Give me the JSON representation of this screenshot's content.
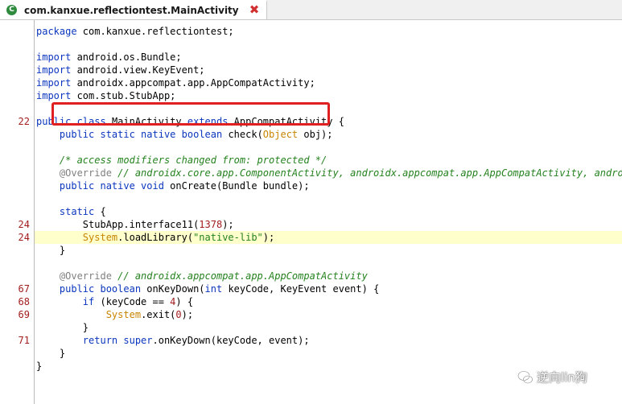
{
  "tab": {
    "icon_letter": "C",
    "title": "com.kanxue.reflectiontest.MainActivity"
  },
  "code": {
    "package_kw": "package",
    "package_name": " com.kanxue.reflectiontest;",
    "import_kw": "import",
    "imports": [
      " android.os.Bundle;",
      " android.view.KeyEvent;",
      " androidx.appcompat.app.AppCompatActivity;",
      " com.stub.StubApp;"
    ],
    "class_decl": {
      "public": "public",
      "class": "class",
      "name": " MainActivity ",
      "extends": "extends",
      "parent": " AppCompatActivity {"
    },
    "native_decl": {
      "mods": "public static native",
      "type": "boolean",
      "rest1": " check(",
      "param_type": "Object",
      "rest2": " obj);"
    },
    "comment1": "/* access modifiers changed from: protected */",
    "override1": "@Override",
    "comment2": " // androidx.core.app.ComponentActivity, androidx.appcompat.app.AppCompatActivity, androidx.",
    "oncreate": {
      "mods": "public native void",
      "rest": " onCreate(Bundle bundle);"
    },
    "static_kw": "static",
    "static_brace": " {",
    "stub_call": {
      "pre": "StubApp.interface11(",
      "num": "1378",
      "post": ");"
    },
    "load": {
      "sys": "System",
      "mid": ".loadLibrary(",
      "str": "\"native-lib\"",
      "post": ");"
    },
    "close_brace": "}",
    "override2": "@Override",
    "comment3": " // androidx.appcompat.app.AppCompatActivity",
    "onkeydown": {
      "mods": "public boolean",
      "mid": " onKeyDown(",
      "int": "int",
      "rest": " keyCode, KeyEvent event) {"
    },
    "if_stmt": {
      "kw": "if",
      "pre": " (keyCode == ",
      "num": "4",
      "post": ") {"
    },
    "exit_stmt": {
      "sys": "System",
      "mid": ".exit(",
      "num": "0",
      "post": ");"
    },
    "return_stmt": {
      "kw": "return super",
      "rest": ".onKeyDown(keyCode, event);"
    }
  },
  "line_numbers": {
    "class": "22",
    "static1": "24",
    "static2": "24",
    "keydown": "67",
    "if": "68",
    "exit": "69",
    "return": "71"
  },
  "watermark": {
    "text": "逆向lin狗"
  },
  "colors": {
    "keyword": "#0b36bd",
    "line_number": "#a11d1d",
    "string": "#25821f",
    "highlight": "#ffffcc",
    "box": "#e02020"
  }
}
